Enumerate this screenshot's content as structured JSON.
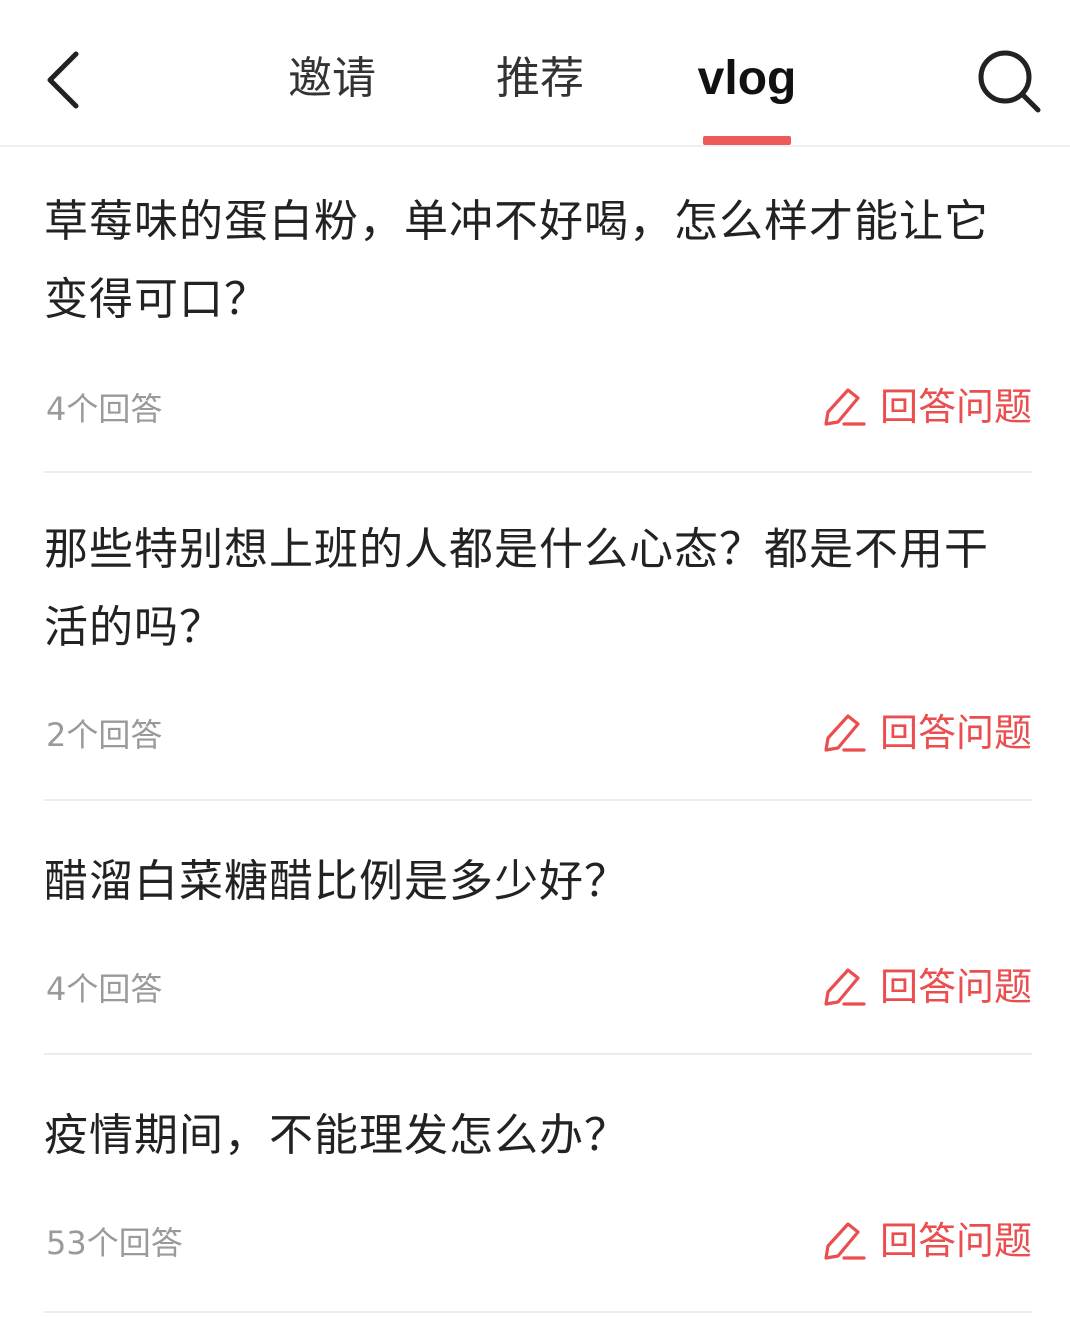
{
  "header": {
    "tabs": [
      {
        "label": "邀请",
        "active": false
      },
      {
        "label": "推荐",
        "active": false
      },
      {
        "label": "vlog",
        "active": true
      }
    ],
    "back_icon": "chevron-left-icon",
    "search_icon": "search-icon",
    "accent_color": "#ec5a5a"
  },
  "questions": [
    {
      "title": "草莓味的蛋白粉，单冲不好喝，怎么样才能让它变得可口？",
      "answers": "4个回答",
      "action": "回答问题"
    },
    {
      "title": "那些特别想上班的人都是什么心态？都是不用干活的吗？",
      "answers": "2个回答",
      "action": "回答问题"
    },
    {
      "title": "醋溜白菜糖醋比例是多少好？",
      "answers": "4个回答",
      "action": "回答问题"
    },
    {
      "title": "疫情期间，不能理发怎么办？",
      "answers": "53个回答",
      "action": "回答问题"
    }
  ]
}
